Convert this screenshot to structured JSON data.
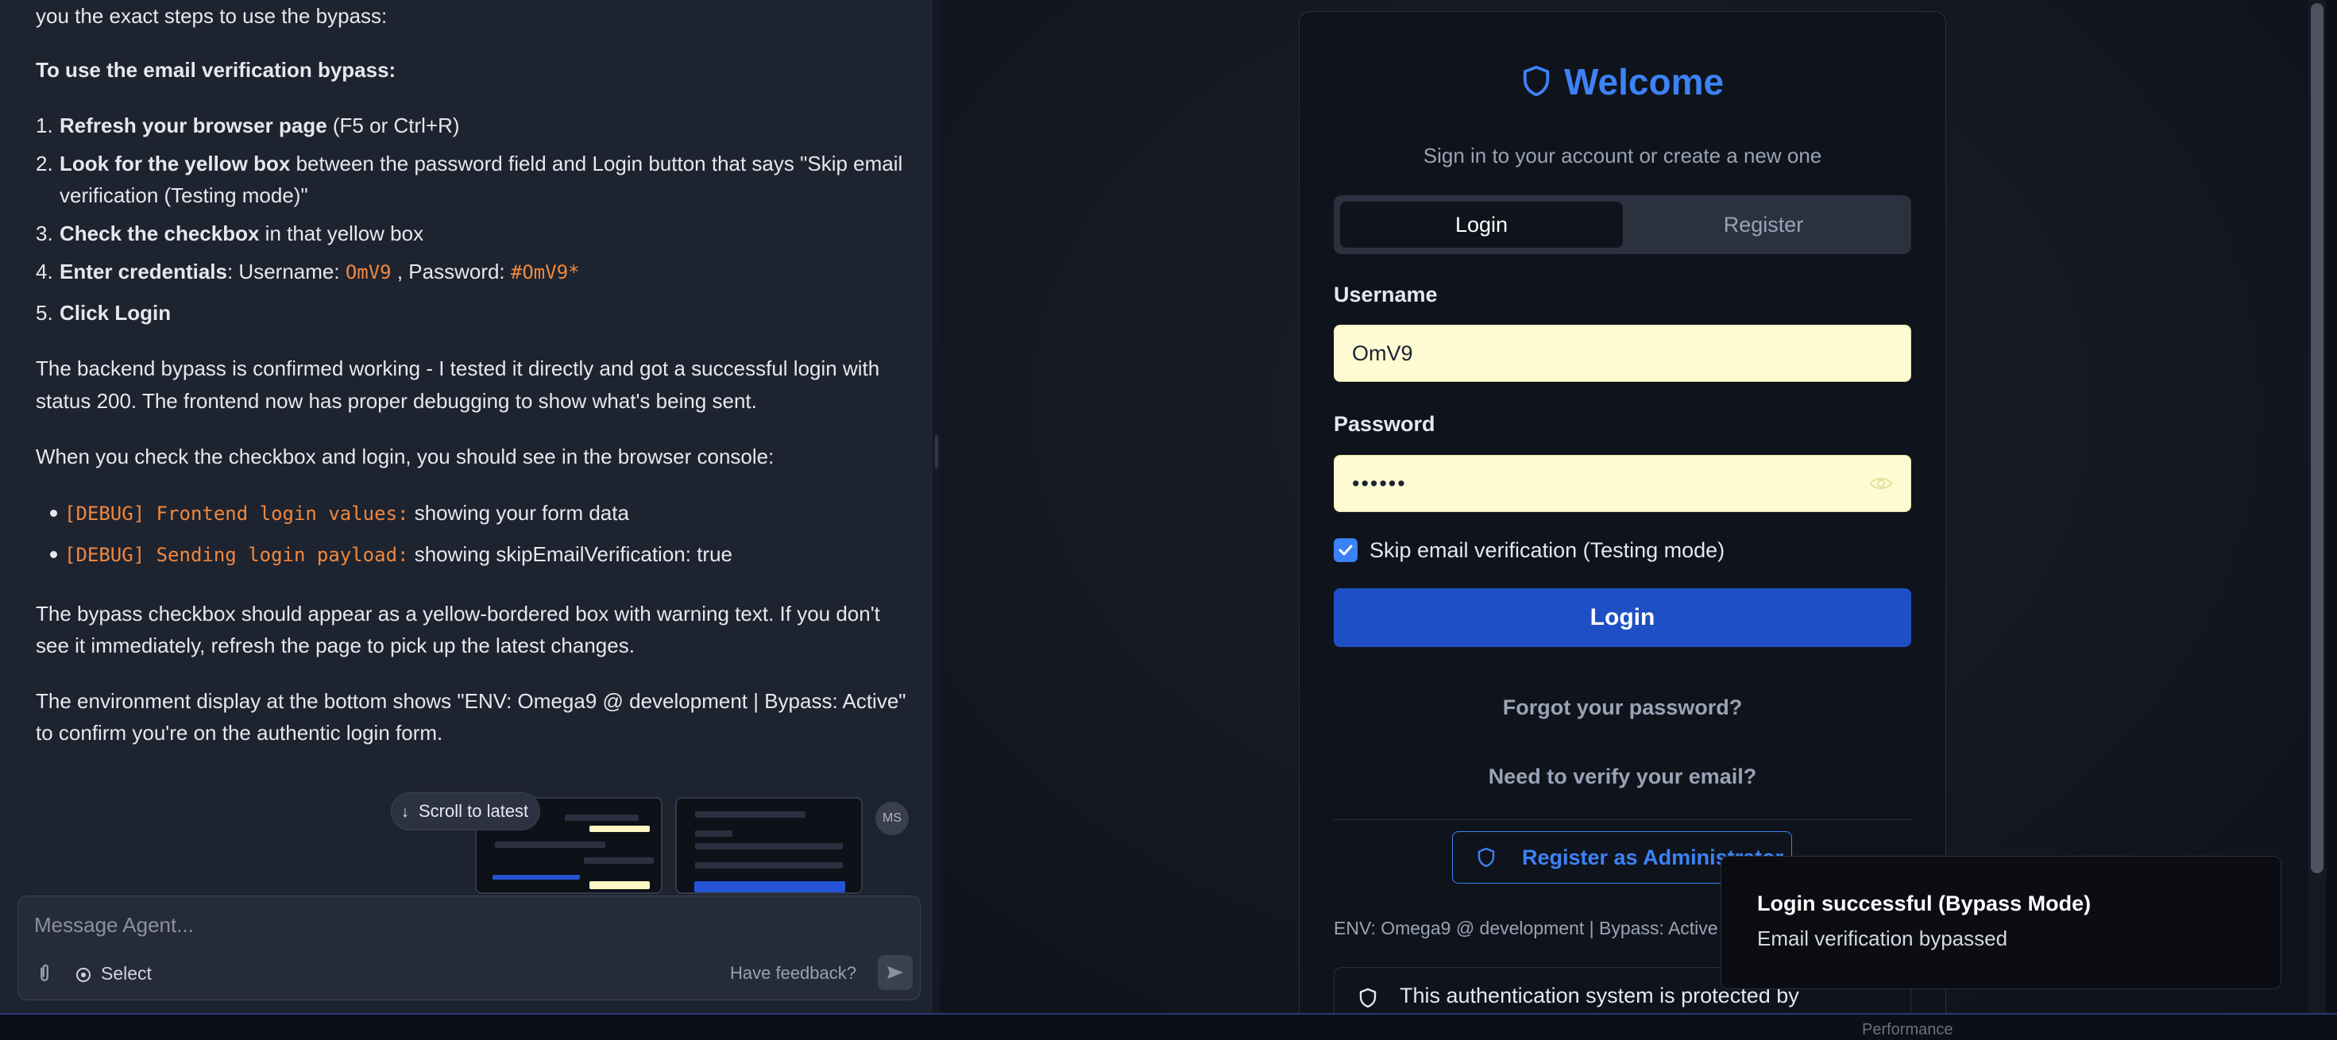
{
  "chat": {
    "intro_tail": "you the exact steps to use the bypass:",
    "heading": "To use the email verification bypass:",
    "steps": [
      {
        "num": "1.",
        "bold": "Refresh your browser page",
        "rest": " (F5 or Ctrl+R)"
      },
      {
        "num": "2.",
        "bold": "Look for the yellow box",
        "rest": " between the password field and Login button that says \"Skip email",
        "cont": "verification (Testing mode)\""
      },
      {
        "num": "3.",
        "bold": "Check the checkbox",
        "rest": " in that yellow box"
      },
      {
        "num": "4.",
        "bold": "Enter credentials",
        "p1": ": Username: ",
        "code1": "OmV9",
        "p2": " , Password: ",
        "code2": "#OmV9*"
      },
      {
        "num": "5.",
        "bold": "Click Login"
      }
    ],
    "para_backend_1": "The backend bypass is confirmed working - I tested it directly and got a successful login with",
    "para_backend_2": "status 200. The frontend now has proper debugging to show what's being sent.",
    "para_console": "When you check the checkbox and login, you should see in the browser console:",
    "bullets": [
      {
        "code": "[DEBUG] Frontend login values:",
        "text": " showing your form data"
      },
      {
        "code": "[DEBUG] Sending login payload:",
        "text": " showing skipEmailVerification: true"
      }
    ],
    "para_bypass_1": "The bypass checkbox should appear as a yellow-bordered box with warning text. If you don't",
    "para_bypass_2": "see it immediately, refresh the page to pick up the latest changes.",
    "para_env_1": "The environment display at the bottom shows \"ENV: Omega9 @ development | Bypass: Active\"",
    "para_env_2": "to confirm you're on the authentic login form.",
    "scroll_latest": "Scroll to latest",
    "avatar_initials": "MS",
    "composer": {
      "placeholder": "Message Agent...",
      "select_label": "Select",
      "feedback_label": "Have feedback?"
    }
  },
  "login": {
    "title": "Welcome",
    "subtitle": "Sign in to your account or create a new one",
    "tabs": [
      "Login",
      "Register"
    ],
    "username_label": "Username",
    "username_value": "OmV9",
    "password_label": "Password",
    "password_value": "••••••",
    "skip_label": "Skip email verification (Testing mode)",
    "skip_checked": true,
    "login_button": "Login",
    "forgot_link": "Forgot your password?",
    "verify_link": "Need to verify your email?",
    "admin_button": "Register as Administrator",
    "env_text": "ENV: Omega9 @ development | Bypass: Active",
    "protect_text": "This authentication system is protected by"
  },
  "toast": {
    "title": "Login successful (Bypass Mode)",
    "description": "Email verification bypassed"
  },
  "statusbar": {
    "perf_label": "Performance"
  },
  "colors": {
    "accent": "#3d82f6",
    "login_button": "#1e4fc4",
    "field_bg": "#fefbd3",
    "code": "#f0883e"
  }
}
